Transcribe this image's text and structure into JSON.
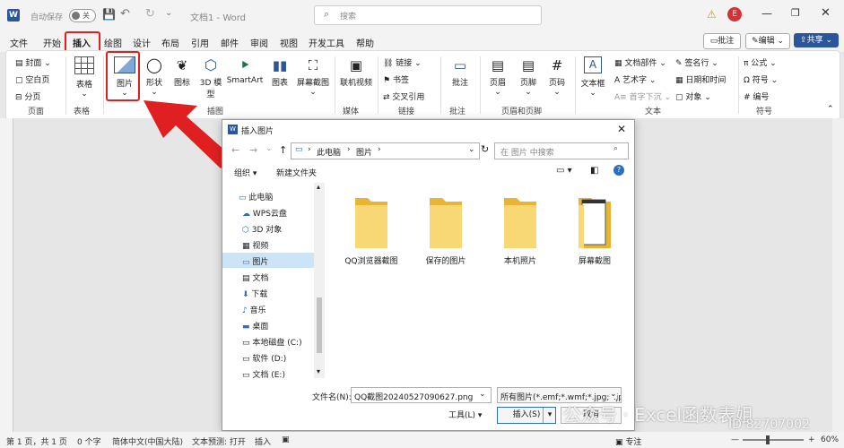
{
  "titlebar": {
    "autosave_label": "自动保存",
    "autosave_state": "关",
    "doc_title": "文档1 - Word",
    "search_placeholder": "搜索",
    "avatar_letter": "E"
  },
  "menu_tabs": [
    "文件",
    "开始",
    "插入",
    "绘图",
    "设计",
    "布局",
    "引用",
    "邮件",
    "审阅",
    "视图",
    "开发工具",
    "帮助"
  ],
  "top_right": {
    "comments": "批注",
    "edit": "编辑",
    "share": "共享"
  },
  "ribbon": {
    "pages": [
      "封面",
      "空白页",
      "分页"
    ],
    "pages_group": "页面",
    "table": "表格",
    "table_group": "表格",
    "picture": "图片",
    "shapes": "形状",
    "icons": "图标",
    "model3d": "3D 模型",
    "smartart": "SmartArt",
    "chart": "图表",
    "screenshot": "屏幕截图",
    "illus_group": "插图",
    "online_video": "联机视频",
    "media_group": "媒体",
    "links": [
      "链接",
      "书签",
      "交叉引用"
    ],
    "links_group": "链接",
    "comment": "批注",
    "comment_group": "批注",
    "header": "页眉",
    "footer": "页脚",
    "pagenum": "页码",
    "hf_group": "页眉和页脚",
    "textbox": "文本框",
    "text_items": [
      "文档部件",
      "艺术字",
      "首字下沉"
    ],
    "text_items2": [
      "签名行",
      "日期和时间",
      "对象"
    ],
    "text_group": "文本",
    "symbols": [
      "公式",
      "符号",
      "编号"
    ],
    "symbols_group": "符号"
  },
  "dialog": {
    "title": "插入图片",
    "breadcrumb": [
      "此电脑",
      "图片"
    ],
    "search_placeholder": "在 图片 中搜索",
    "organize": "组织",
    "new_folder": "新建文件夹",
    "sidebar": [
      "此电脑",
      "WPS云盘",
      "3D 对象",
      "视频",
      "图片",
      "文档",
      "下载",
      "音乐",
      "桌面",
      "本地磁盘 (C:)",
      "软件 (D:)",
      "文档 (E:)"
    ],
    "folders": [
      "QQ浏览器截图",
      "保存的图片",
      "本机照片",
      "屏幕截图"
    ],
    "filename_label": "文件名(N):",
    "filename_value": "QQ截图20240527090627.png",
    "filetype_value": "所有图片(*.emf;*.wmf;*.jpg;*.jp",
    "tools": "工具(L)",
    "insert": "插入(S)",
    "cancel": "取消"
  },
  "statusbar": {
    "page": "第 1 页，共 1 页",
    "words": "0 个字",
    "lang": "简体中文(中国大陆)",
    "predict": "文本预测: 打开",
    "mode": "插入",
    "focus": "专注",
    "zoom": "60%"
  },
  "watermark": {
    "text1": "公众号 · Excel函数表姐",
    "text2": "ID:82707002"
  },
  "colors": {
    "accent": "#e02020",
    "word_blue": "#2b579a",
    "folder": "#f5c94a"
  }
}
